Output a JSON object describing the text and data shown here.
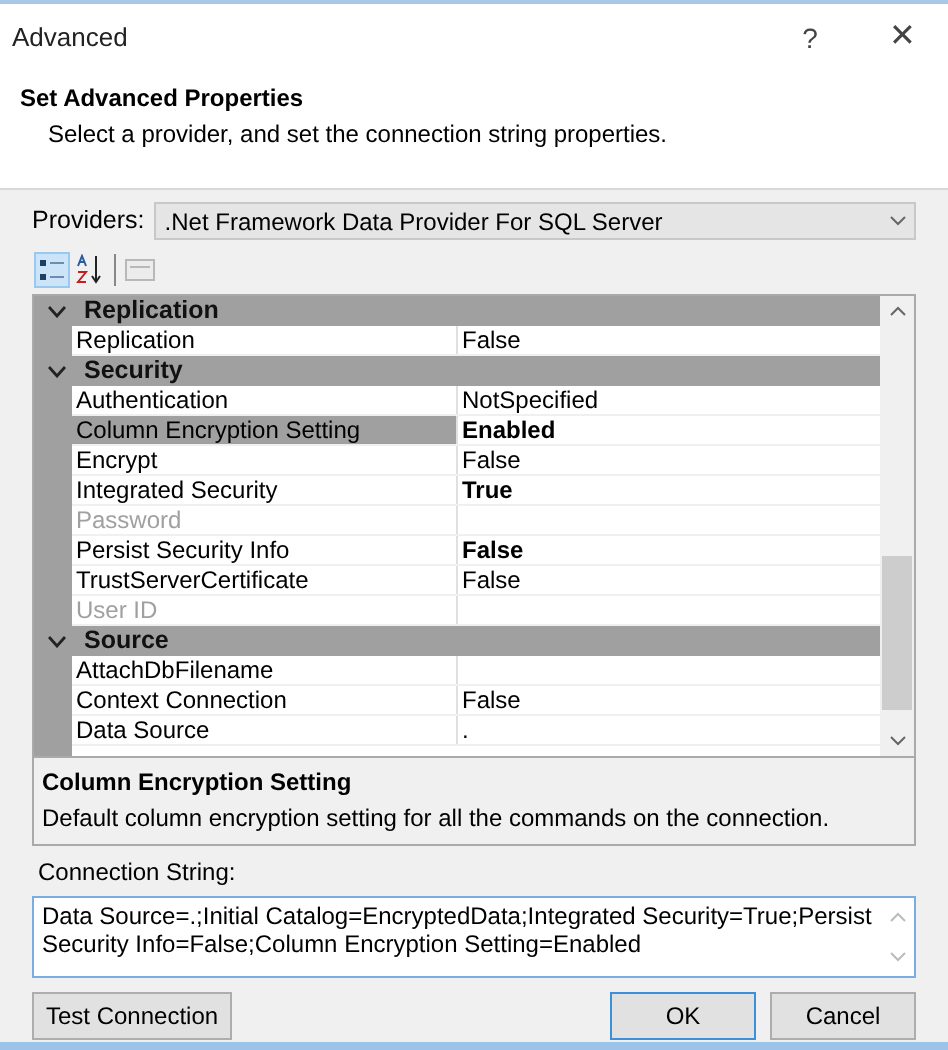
{
  "window": {
    "title": "Advanced",
    "help": "?",
    "close": "✕"
  },
  "header": {
    "title": "Set Advanced Properties",
    "subtitle": "Select a provider, and set the connection string properties."
  },
  "providers": {
    "label": "Providers:",
    "value": ".Net Framework Data Provider For SQL Server"
  },
  "toolbar": [
    {
      "kind": "categorized",
      "selected": true,
      "disabled": false
    },
    {
      "kind": "alphabetical",
      "selected": false,
      "disabled": false
    },
    {
      "kind": "pages",
      "selected": false,
      "disabled": true
    }
  ],
  "grid": {
    "categories": [
      {
        "name": "Replication",
        "expanded": true,
        "properties": [
          {
            "name": "Replication",
            "value": "False",
            "bold": false,
            "disabled": false,
            "selected": false
          }
        ]
      },
      {
        "name": "Security",
        "expanded": true,
        "properties": [
          {
            "name": "Authentication",
            "value": "NotSpecified",
            "bold": false,
            "disabled": false,
            "selected": false
          },
          {
            "name": "Column Encryption Setting",
            "value": "Enabled",
            "bold": true,
            "disabled": false,
            "selected": true
          },
          {
            "name": "Encrypt",
            "value": "False",
            "bold": false,
            "disabled": false,
            "selected": false
          },
          {
            "name": "Integrated Security",
            "value": "True",
            "bold": true,
            "disabled": false,
            "selected": false
          },
          {
            "name": "Password",
            "bold": false,
            "disabled": true,
            "selected": false
          },
          {
            "name": "Persist Security Info",
            "value": "False",
            "bold": true,
            "disabled": false,
            "selected": false
          },
          {
            "name": "TrustServerCertificate",
            "value": "False",
            "bold": false,
            "disabled": false,
            "selected": false
          },
          {
            "name": "User ID",
            "bold": false,
            "disabled": true,
            "selected": false
          }
        ]
      },
      {
        "name": "Source",
        "expanded": true,
        "properties": [
          {
            "name": "AttachDbFilename",
            "bold": false,
            "disabled": false,
            "selected": false
          },
          {
            "name": "Context Connection",
            "value": "False",
            "bold": false,
            "disabled": false,
            "selected": false
          },
          {
            "name": "Data Source",
            "value": ".",
            "bold": false,
            "disabled": false,
            "selected": false
          }
        ]
      }
    ]
  },
  "description": {
    "title": "Column Encryption Setting",
    "text": "Default column encryption setting for all the commands on the connection."
  },
  "connection_string": {
    "label": "Connection String:",
    "value": "Data Source=.;Initial Catalog=EncryptedData;Integrated Security=True;Persist Security Info=False;Column Encryption Setting=Enabled"
  },
  "buttons": [
    {
      "label": "Test Connection",
      "kind": "test",
      "default": false
    },
    {
      "label": "OK",
      "kind": "ok",
      "default": true
    },
    {
      "label": "Cancel",
      "kind": "cancel",
      "default": false
    }
  ]
}
